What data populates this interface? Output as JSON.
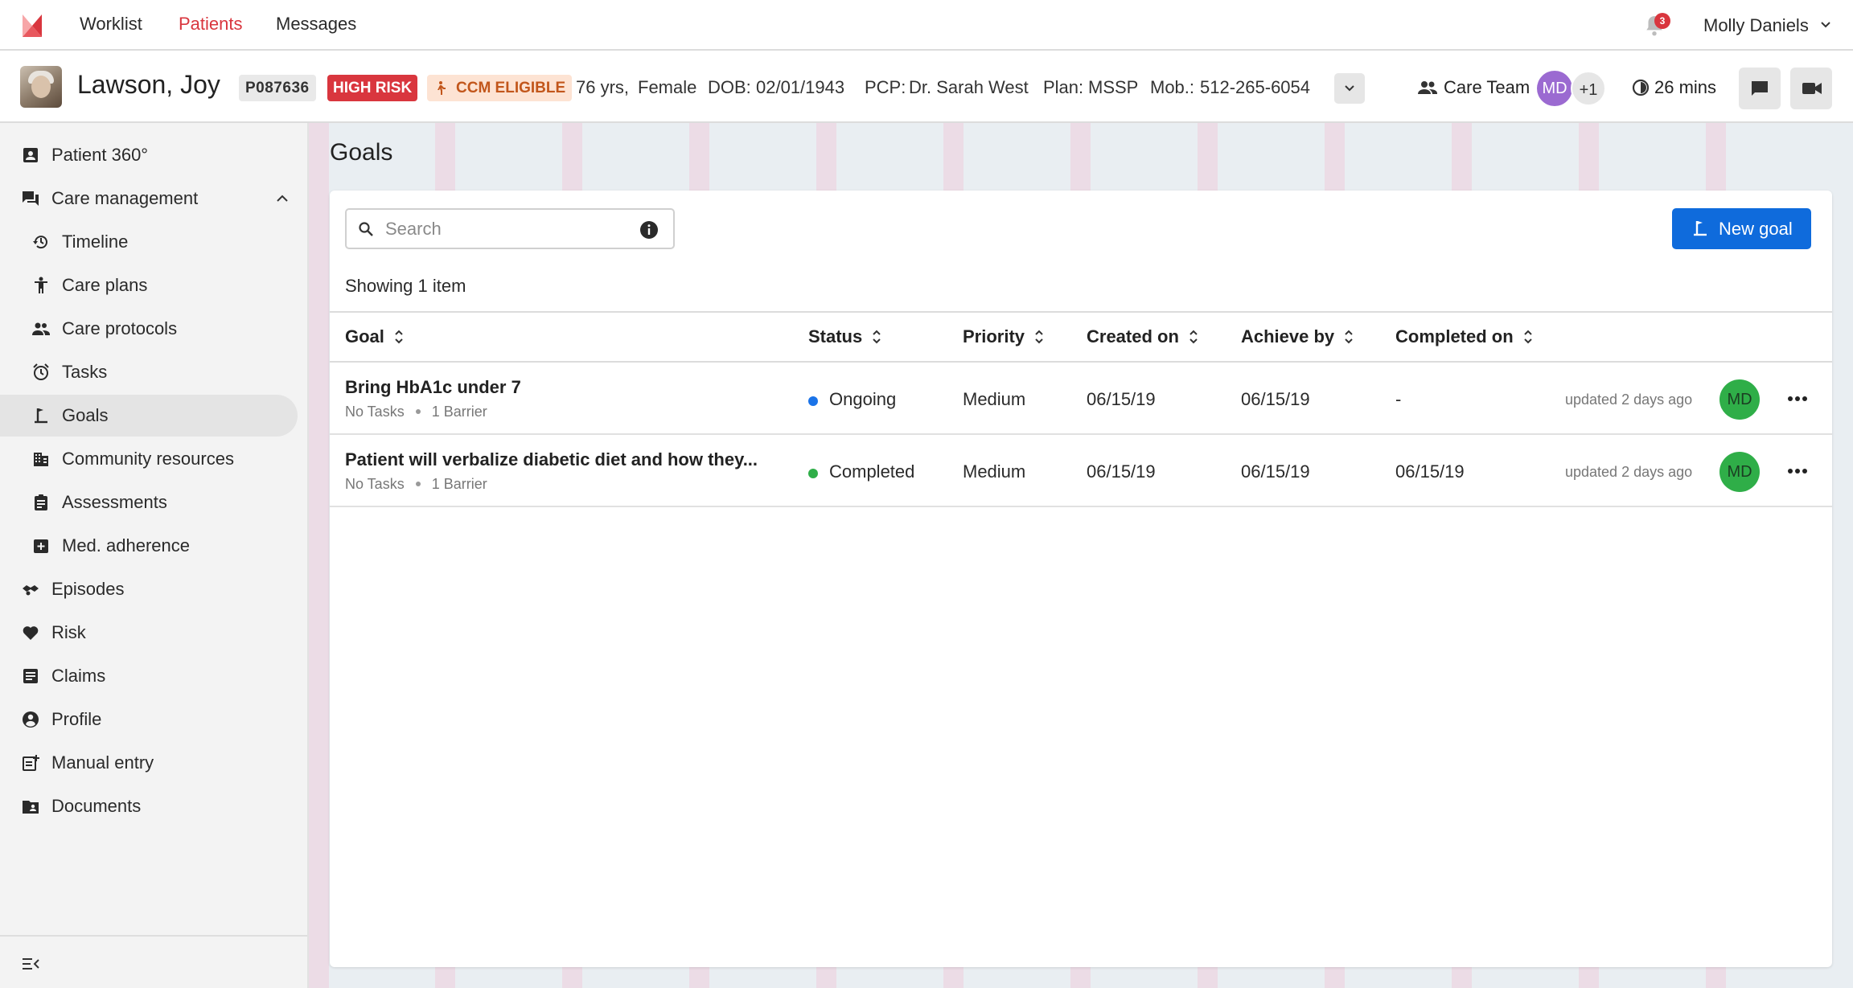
{
  "topnav": {
    "links": [
      {
        "label": "Worklist"
      },
      {
        "label": "Patients"
      },
      {
        "label": "Messages"
      }
    ],
    "notification_count": "3",
    "user_name": "Molly Daniels"
  },
  "patient": {
    "name": "Lawson, Joy",
    "id": "P087636",
    "risk_badge": "HIGH RISK",
    "ccm_badge": "CCM ELIGIBLE",
    "age_label": "76 yrs,",
    "sex": "Female",
    "dob_label": "DOB:",
    "dob": "02/01/1943",
    "pcp_label": "PCP:",
    "pcp": "Dr. Sarah West",
    "plan_label": "Plan:",
    "plan": "MSSP",
    "mob_label": "Mob.:",
    "mob": "512-265-6054",
    "care_team_label": "Care Team",
    "care_team_initials": "MD",
    "care_team_more": "+1",
    "timer": "26 mins"
  },
  "sidebar": {
    "items": [
      {
        "label": "Patient 360°",
        "icon": "patient-card-icon"
      },
      {
        "label": "Care management",
        "icon": "chat-bubbles-icon"
      },
      {
        "label": "Timeline",
        "icon": "history-icon"
      },
      {
        "label": "Care plans",
        "icon": "person-icon"
      },
      {
        "label": "Care protocols",
        "icon": "people-icon"
      },
      {
        "label": "Tasks",
        "icon": "alarm-clock-icon"
      },
      {
        "label": "Goals",
        "icon": "goal-icon"
      },
      {
        "label": "Community resources",
        "icon": "building-icon"
      },
      {
        "label": "Assessments",
        "icon": "clipboard-icon"
      },
      {
        "label": "Med. adherence",
        "icon": "medication-icon"
      },
      {
        "label": "Episodes",
        "icon": "episodes-icon"
      },
      {
        "label": "Risk",
        "icon": "heart-icon"
      },
      {
        "label": "Claims",
        "icon": "document-lines-icon"
      },
      {
        "label": "Profile",
        "icon": "account-circle-icon"
      },
      {
        "label": "Manual entry",
        "icon": "manual-entry-icon"
      },
      {
        "label": "Documents",
        "icon": "folder-person-icon"
      }
    ]
  },
  "main": {
    "title": "Goals",
    "search_placeholder": "Search",
    "new_goal_label": "New goal",
    "showing_label": "Showing 1 item",
    "columns": [
      "Goal",
      "Status",
      "Priority",
      "Created on",
      "Achieve by",
      "Completed on"
    ],
    "rows": [
      {
        "goal": "Bring HbA1c under 7",
        "tasks": "No Tasks",
        "barriers": "1 Barrier",
        "status": "Ongoing",
        "status_color": "#1a73e8",
        "priority": "Medium",
        "created_on": "06/15/19",
        "achieve_by": "06/15/19",
        "completed_on": "-",
        "updated": "updated 2 days ago",
        "owner_initials": "MD"
      },
      {
        "goal": "Patient will verbalize diabetic diet and how they...",
        "tasks": "No Tasks",
        "barriers": "1 Barrier",
        "status": "Completed",
        "status_color": "#2fae48",
        "priority": "Medium",
        "created_on": "06/15/19",
        "achieve_by": "06/15/19",
        "completed_on": "06/15/19",
        "updated": "updated 2 days ago",
        "owner_initials": "MD"
      }
    ]
  },
  "colors": {
    "accent_red": "#d9363e",
    "primary_blue": "#0f6bdc",
    "ccm_bg": "#fde3d3",
    "ccm_text": "#c2561b"
  }
}
